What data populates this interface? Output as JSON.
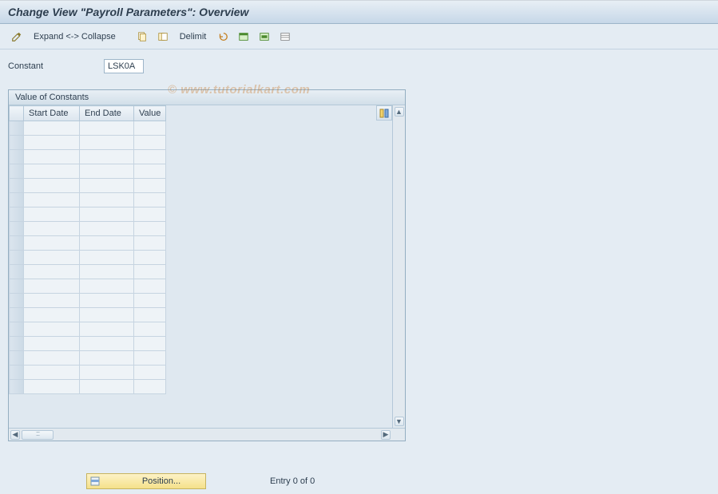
{
  "title": "Change View \"Payroll Parameters\": Overview",
  "toolbar": {
    "expand_collapse": "Expand <-> Collapse",
    "delimit": "Delimit"
  },
  "field": {
    "constant_label": "Constant",
    "constant_value": "LSK0A"
  },
  "panel": {
    "title": "Value of Constants",
    "columns": {
      "start_date": "Start Date",
      "end_date": "End Date",
      "value": "Value"
    },
    "rows": [
      {
        "start": "",
        "end": "",
        "value": ""
      },
      {
        "start": "",
        "end": "",
        "value": ""
      },
      {
        "start": "",
        "end": "",
        "value": ""
      },
      {
        "start": "",
        "end": "",
        "value": ""
      },
      {
        "start": "",
        "end": "",
        "value": ""
      },
      {
        "start": "",
        "end": "",
        "value": ""
      },
      {
        "start": "",
        "end": "",
        "value": ""
      },
      {
        "start": "",
        "end": "",
        "value": ""
      },
      {
        "start": "",
        "end": "",
        "value": ""
      },
      {
        "start": "",
        "end": "",
        "value": ""
      },
      {
        "start": "",
        "end": "",
        "value": ""
      },
      {
        "start": "",
        "end": "",
        "value": ""
      },
      {
        "start": "",
        "end": "",
        "value": ""
      },
      {
        "start": "",
        "end": "",
        "value": ""
      },
      {
        "start": "",
        "end": "",
        "value": ""
      },
      {
        "start": "",
        "end": "",
        "value": ""
      },
      {
        "start": "",
        "end": "",
        "value": ""
      },
      {
        "start": "",
        "end": "",
        "value": ""
      },
      {
        "start": "",
        "end": "",
        "value": ""
      }
    ]
  },
  "footer": {
    "position_label": "Position...",
    "entry_text": "Entry 0 of 0"
  },
  "icons": {
    "pencil": "pencil-icon",
    "copy": "copy-icon",
    "toggle": "toggle-icon",
    "undo": "undo-icon",
    "select_all": "select-all-icon",
    "select_block": "select-block-icon",
    "deselect": "deselect-icon",
    "config": "configure-columns-icon",
    "position": "position-icon"
  },
  "watermark": "© www.tutorialkart.com"
}
